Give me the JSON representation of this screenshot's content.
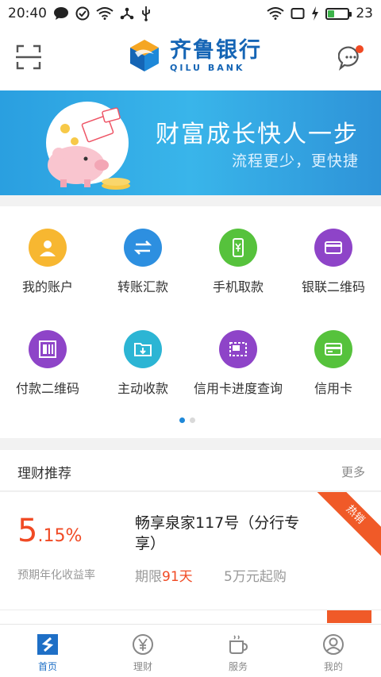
{
  "status_bar": {
    "time": "20:40",
    "battery_level": "23",
    "battery_fill_percent": 0.3
  },
  "header": {
    "bank_name_cn": "齐鲁银行",
    "bank_name_en": "QILU BANK",
    "scan_icon": "scan-icon",
    "message_icon": "message-icon"
  },
  "banner": {
    "title": "财富成长快人一步",
    "subtitle": "流程更少，更快捷"
  },
  "services": [
    {
      "label": "我的账户",
      "icon": "account-icon",
      "color": "#f7b731"
    },
    {
      "label": "转账汇款",
      "icon": "transfer-icon",
      "color": "#2d8fe0"
    },
    {
      "label": "手机取款",
      "icon": "mobile-withdraw-icon",
      "color": "#56c23c"
    },
    {
      "label": "银联二维码",
      "icon": "unionpay-qr-icon",
      "color": "#8e44c8"
    },
    {
      "label": "付款二维码",
      "icon": "pay-qr-icon",
      "color": "#8e44c8"
    },
    {
      "label": "主动收款",
      "icon": "collect-icon",
      "color": "#2cb5d4"
    },
    {
      "label": "信用卡进度查询",
      "icon": "credit-progress-icon",
      "color": "#8e44c8"
    },
    {
      "label": "信用卡",
      "icon": "credit-card-icon",
      "color": "#56c23c"
    }
  ],
  "pagination": {
    "current": 1,
    "total": 2
  },
  "finance": {
    "title": "理财推荐",
    "more": "更多",
    "product": {
      "rate_int": "5",
      "rate_dec": ".15%",
      "rate_label": "预期年化收益率",
      "name": "畅享泉家117号（分行专享）",
      "term_prefix": "期限",
      "term_value": "91天",
      "min_amount": "5万元起购",
      "badge": "热销"
    }
  },
  "tabs": [
    {
      "label": "首页",
      "icon": "home-icon",
      "active": true
    },
    {
      "label": "理财",
      "icon": "yen-icon",
      "active": false
    },
    {
      "label": "服务",
      "icon": "service-cup-icon",
      "active": false
    },
    {
      "label": "我的",
      "icon": "profile-icon",
      "active": false
    }
  ],
  "colors": {
    "brand_blue": "#1565b5",
    "accent_orange": "#f04a24",
    "banner_blue": "#2a9fe0",
    "tab_active": "#1e6fc6"
  }
}
